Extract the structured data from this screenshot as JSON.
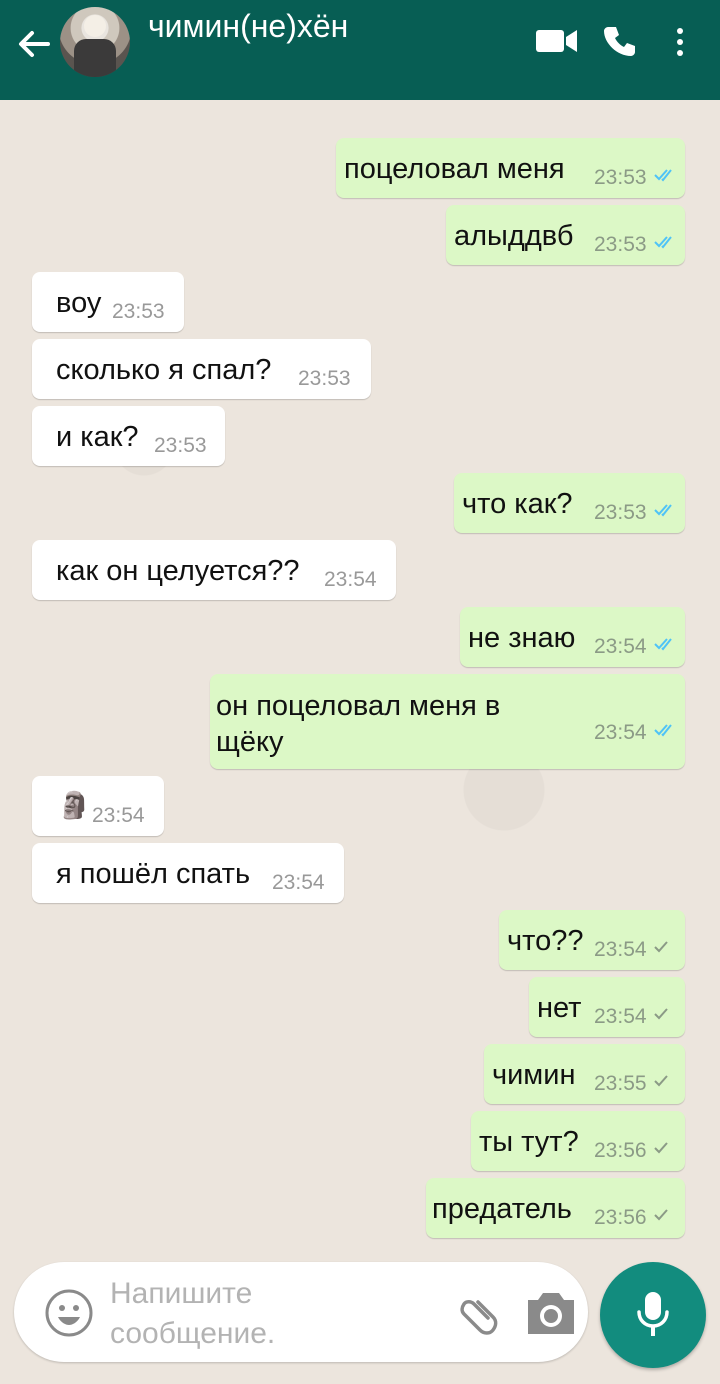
{
  "header": {
    "contact_name": "чимин(не)хён",
    "icons": [
      "back-arrow-icon",
      "video-call-icon",
      "phone-icon",
      "more-vert-icon"
    ]
  },
  "messages": [
    {
      "dir": "out",
      "text": "поцеловал меня",
      "time": "23:53",
      "status": "read"
    },
    {
      "dir": "out",
      "text": "алыддвб",
      "time": "23:53",
      "status": "read"
    },
    {
      "dir": "in",
      "text": "воу",
      "time": "23:53"
    },
    {
      "dir": "in",
      "text": "сколько я спал?",
      "time": "23:53"
    },
    {
      "dir": "in",
      "text": "и как?",
      "time": "23:53"
    },
    {
      "dir": "out",
      "text": "что как?",
      "time": "23:53",
      "status": "read"
    },
    {
      "dir": "in",
      "text": "как он целуется??",
      "time": "23:54"
    },
    {
      "dir": "out",
      "text": "не знаю",
      "time": "23:54",
      "status": "read"
    },
    {
      "dir": "out",
      "text": "он поцеловал меня в щёку",
      "line1": "он поцеловал меня в",
      "line2": "щёку",
      "time": "23:54",
      "status": "read"
    },
    {
      "dir": "in",
      "text": "🗿",
      "time": "23:54"
    },
    {
      "dir": "in",
      "text": "я пошёл спать",
      "time": "23:54"
    },
    {
      "dir": "out",
      "text": "что??",
      "time": "23:54",
      "status": "sent"
    },
    {
      "dir": "out",
      "text": "нет",
      "time": "23:54",
      "status": "sent"
    },
    {
      "dir": "out",
      "text": "чимин",
      "time": "23:55",
      "status": "sent"
    },
    {
      "dir": "out",
      "text": "ты тут?",
      "time": "23:56",
      "status": "sent"
    },
    {
      "dir": "out",
      "text": "предатель",
      "time": "23:56",
      "status": "sent"
    }
  ],
  "composer": {
    "placeholder": "Напишите сообщение.",
    "placeholder_line1": "Напишите",
    "placeholder_line2": "сообщение."
  },
  "colors": {
    "header": "#075e54",
    "outgoing_bubble": "#dcf8c6",
    "incoming_bubble": "#ffffff",
    "read_ticks": "#4fc3f7",
    "mic_button": "#128c7e"
  }
}
